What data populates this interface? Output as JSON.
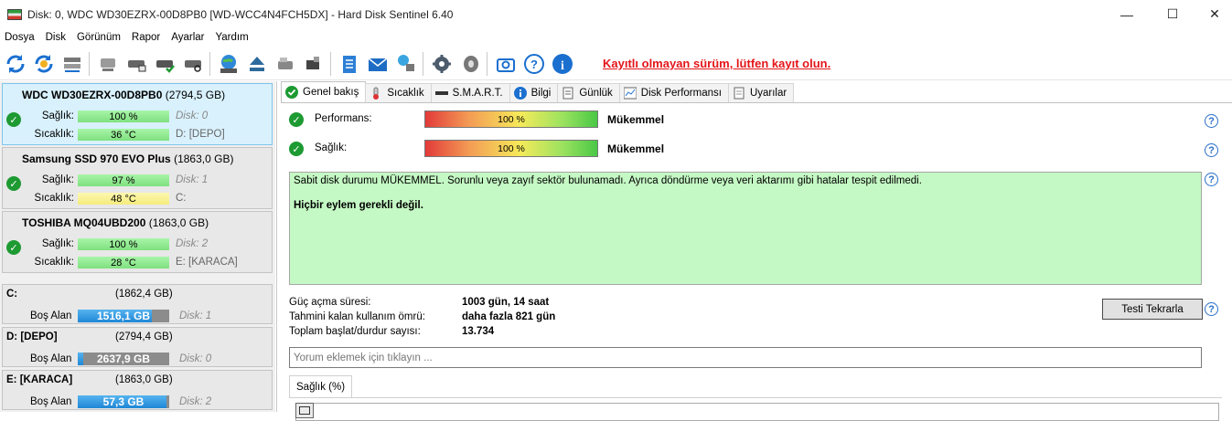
{
  "window": {
    "title": "Disk: 0, WDC WD30EZRX-00D8PB0 [WD-WCC4N4FCH5DX]  -  Hard Disk Sentinel 6.40",
    "minimize": "—",
    "maximize": "☐",
    "close": "✕"
  },
  "menu": [
    "Dosya",
    "Disk",
    "Görünüm",
    "Rapor",
    "Ayarlar",
    "Yardım"
  ],
  "toolbar": {
    "icons": [
      "refresh-icon",
      "refresh-all-icon",
      "disk-details-icon",
      "disk-gray-icon",
      "disk-test-icon",
      "disk-check-icon",
      "disk-search-icon",
      "globe-disk-icon",
      "eject-icon",
      "usb-disk-icon",
      "ssd-icon",
      "report-icon",
      "mail-icon",
      "network-icon",
      "settings-icon",
      "sound-icon",
      "screenshot-icon",
      "help-icon",
      "info-icon"
    ],
    "registration_link": "Kayıtlı olmayan sürüm, lütfen kayıt olun."
  },
  "disks": [
    {
      "name": "WDC WD30EZRX-00D8PB0",
      "size": "(2794,5 GB)",
      "health_label": "Sağlık:",
      "health": "100 %",
      "health_pct": 100,
      "temp_label": "Sıcaklık:",
      "temp": "36 °C",
      "temp_color": "green",
      "disk_no": "Disk: 0",
      "volumes": "D: [DEPO]",
      "selected": true
    },
    {
      "name": "Samsung SSD 970 EVO Plus",
      "size": "(1863,0 GB)",
      "health_label": "Sağlık:",
      "health": "97 %",
      "health_pct": 97,
      "temp_label": "Sıcaklık:",
      "temp": "48 °C",
      "temp_color": "yellow",
      "disk_no": "Disk: 1",
      "volumes": "C:",
      "selected": false
    },
    {
      "name": "TOSHIBA MQ04UBD200",
      "size": "(1863,0 GB)",
      "health_label": "Sağlık:",
      "health": "100 %",
      "health_pct": 100,
      "temp_label": "Sıcaklık:",
      "temp": "28 °C",
      "temp_color": "green",
      "disk_no": "Disk: 2",
      "volumes": "E: [KARACA]",
      "selected": false
    }
  ],
  "volumes": [
    {
      "name": "C:",
      "size": "(1862,4 GB)",
      "free_label": "Boş Alan",
      "free": "1516,1 GB",
      "free_fraction": 0.81,
      "disk": "Disk: 1"
    },
    {
      "name": "D: [DEPO]",
      "size": "(2794,4 GB)",
      "free_label": "Boş Alan",
      "free": "2637,9 GB",
      "free_fraction": 0.06,
      "disk": "Disk: 0"
    },
    {
      "name": "E: [KARACA]",
      "size": "(1863,0 GB)",
      "free_label": "Boş Alan",
      "free": "57,3 GB",
      "free_fraction": 0.97,
      "disk": "Disk: 2"
    }
  ],
  "tabs": [
    "Genel bakış",
    "Sıcaklık",
    "S.M.A.R.T.",
    "Bilgi",
    "Günlük",
    "Disk Performansı",
    "Uyarılar"
  ],
  "overview": {
    "performance_label": "Performans:",
    "performance_value": "100 %",
    "performance_pct": 100,
    "performance_status": "Mükemmel",
    "health_label": "Sağlık:",
    "health_value": "100 %",
    "health_pct": 100,
    "health_status": "Mükemmel",
    "status_text": "Sabit disk durumu MÜKEMMEL. Sorunlu veya zayıf sektör bulunamadı. Ayrıca döndürme veya veri aktarımı gibi hatalar tespit edilmedi.",
    "action_text": "Hiçbir eylem gerekli değil.",
    "power_on_label": "Güç açma süresi:",
    "power_on_value": "1003 gün, 14 saat",
    "lifetime_label": "Tahmini kalan kullanım ömrü:",
    "lifetime_value": "daha fazla 821 gün",
    "startstop_label": "Toplam başlat/durdur sayısı:",
    "startstop_value": "13.734",
    "retest_button": "Testi Tekrarla",
    "comment_placeholder": "Yorum eklemek için tıklayın ...",
    "health_tab": "Sağlık (%)"
  },
  "colors": {
    "accent_link": "#e4151a",
    "status_bg": "#c4f8c4",
    "check_green": "#1d9a32"
  }
}
